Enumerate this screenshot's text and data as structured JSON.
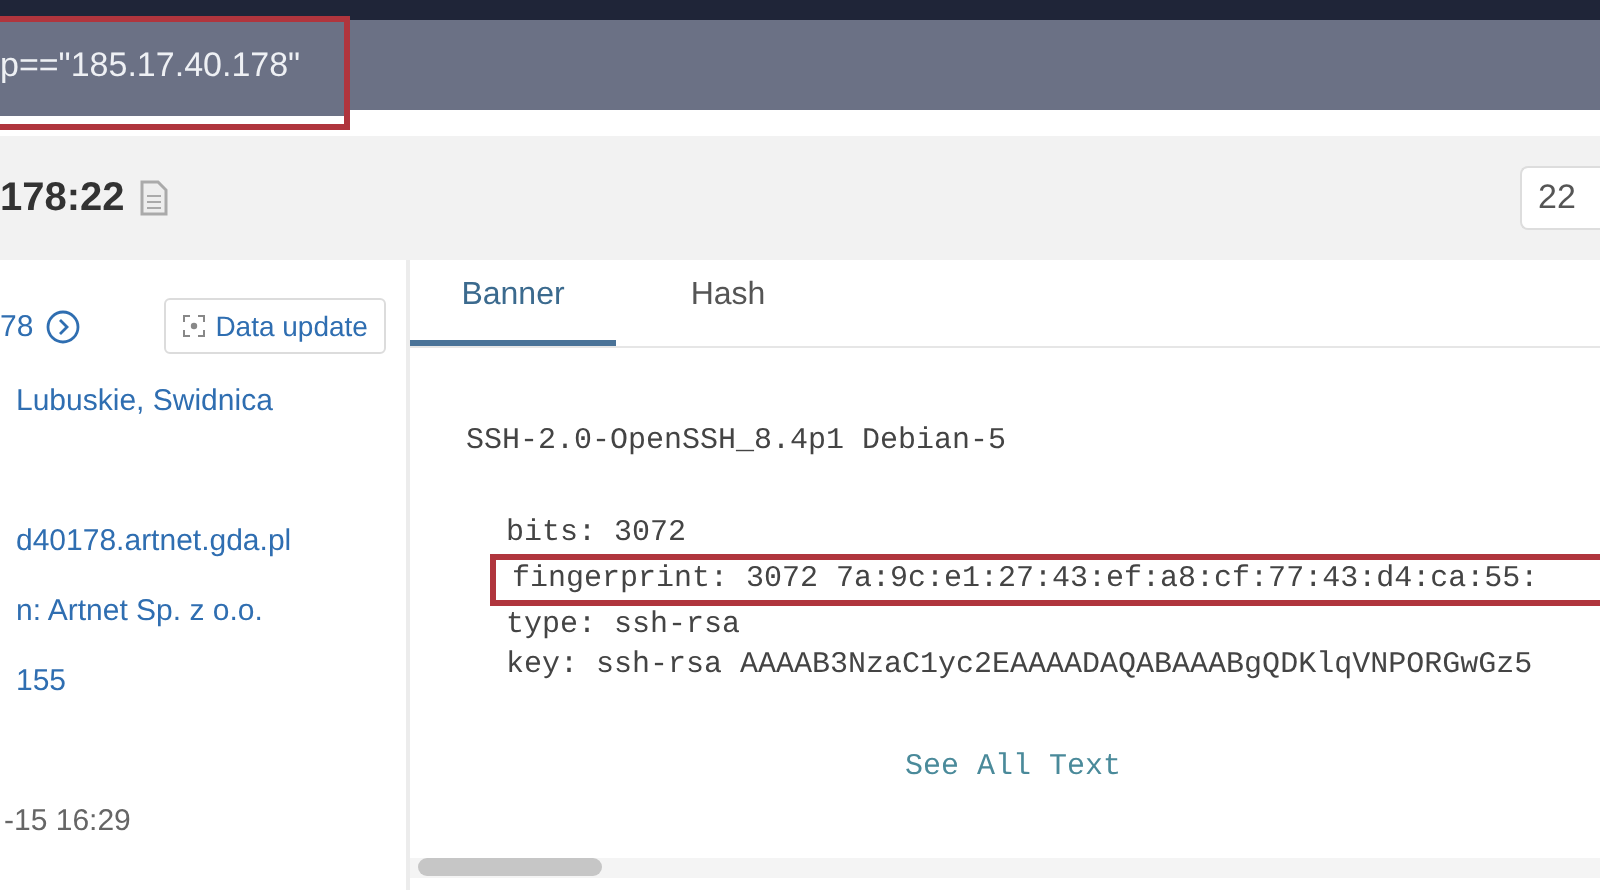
{
  "search": {
    "value": "p==\"185.17.40.178\"",
    "highlighted": true
  },
  "header": {
    "title": "178:22",
    "port_button": "22"
  },
  "info_panel": {
    "ip": "78",
    "update_button": "Data update",
    "rows": [
      {
        "text": "Lubuskie, Swidnica",
        "kind": "link"
      },
      {
        "text": "d40178.artnet.gda.pl",
        "kind": "link"
      },
      {
        "text": "n: Artnet Sp. z o.o.",
        "kind": "link"
      },
      {
        "text": "155",
        "kind": "link"
      },
      {
        "text": "-15 16:29",
        "kind": "plain"
      }
    ]
  },
  "tabs": [
    {
      "label": "Banner",
      "selected": true
    },
    {
      "label": "Hash",
      "selected": false
    }
  ],
  "banner": {
    "title": "SSH-2.0-OpenSSH_8.4p1 Debian-5",
    "lines": [
      {
        "text": "bits: 3072",
        "highlighted": false
      },
      {
        "text": "fingerprint: 3072 7a:9c:e1:27:43:ef:a8:cf:77:43:d4:ca:55:",
        "highlighted": true
      },
      {
        "text": "type: ssh-rsa",
        "highlighted": false
      },
      {
        "text": "key: ssh-rsa AAAAB3NzaC1yc2EAAAADAQABAAABgQDKlqVNPORGwGz5",
        "highlighted": false
      }
    ],
    "more_link": "See All Text"
  }
}
